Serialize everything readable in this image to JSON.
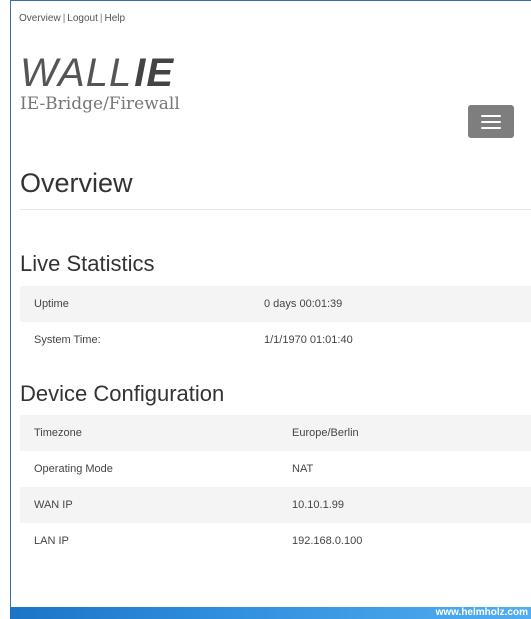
{
  "top_links": [
    "Overview",
    "Logout",
    "Help"
  ],
  "logo": {
    "wall": "WALL",
    "ie": "IE",
    "subtitle": "IE-Bridge/Firewall"
  },
  "page_title": "Overview",
  "live_statistics": {
    "title": "Live Statistics",
    "rows": [
      {
        "label": "Uptime",
        "value": "0 days 00:01:39"
      },
      {
        "label": "System Time:",
        "value": "1/1/1970 01:01:40"
      }
    ]
  },
  "device_configuration": {
    "title": "Device Configuration",
    "rows": [
      {
        "label": "Timezone",
        "value": "Europe/Berlin"
      },
      {
        "label": "Operating Mode",
        "value": "NAT"
      },
      {
        "label": "WAN IP",
        "value": "10.10.1.99"
      },
      {
        "label": "LAN IP",
        "value": "192.168.0.100"
      }
    ]
  },
  "footer_text": "www.helmholz.com",
  "colors": {
    "footer_start": "#1d74c7",
    "footer_end": "#52aef0",
    "menu_button": "#7e7e7e"
  },
  "icons": {
    "menu": "hamburger-menu-icon"
  }
}
